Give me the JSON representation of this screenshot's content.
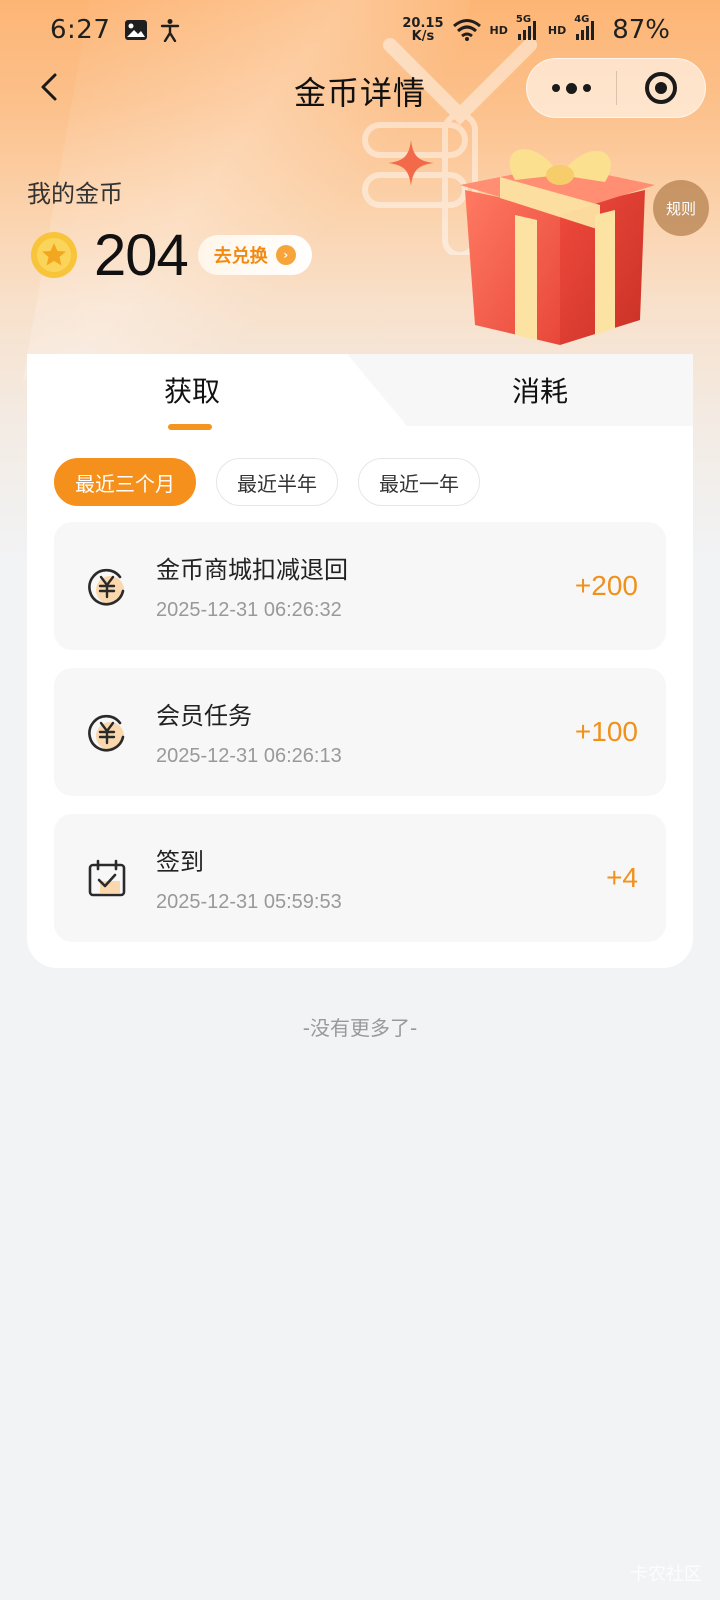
{
  "status_bar": {
    "time": "6:27",
    "net_speed_value": "20.15",
    "net_speed_unit": "K/s",
    "sig1_label": "HD",
    "sig1_type": "5G",
    "sig2_label": "HD",
    "sig2_type": "4G",
    "battery": "87%"
  },
  "nav": {
    "title": "金币详情"
  },
  "summary": {
    "label": "我的金币",
    "coins": "204",
    "redeem_label": "去兑换",
    "rules_label": "规则"
  },
  "tabs": [
    {
      "label": "获取",
      "active": true
    },
    {
      "label": "消耗",
      "active": false
    }
  ],
  "filters": [
    {
      "label": "最近三个月",
      "active": true
    },
    {
      "label": "最近半年",
      "active": false
    },
    {
      "label": "最近一年",
      "active": false
    }
  ],
  "records": [
    {
      "name": "金币商城扣减退回",
      "date": "2025-12-31 06:26:32",
      "amount": "+200",
      "icon": "yen-coin-icon"
    },
    {
      "name": "会员任务",
      "date": "2025-12-31 06:26:13",
      "amount": "+100",
      "icon": "yen-coin-icon"
    },
    {
      "name": "签到",
      "date": "2025-12-31 05:59:53",
      "amount": "+4",
      "icon": "calendar-check-icon"
    }
  ],
  "footer": {
    "no_more": "-没有更多了-",
    "watermark": "卡农社区"
  },
  "colors": {
    "accent": "#f5901c",
    "amount": "#f0911a"
  }
}
